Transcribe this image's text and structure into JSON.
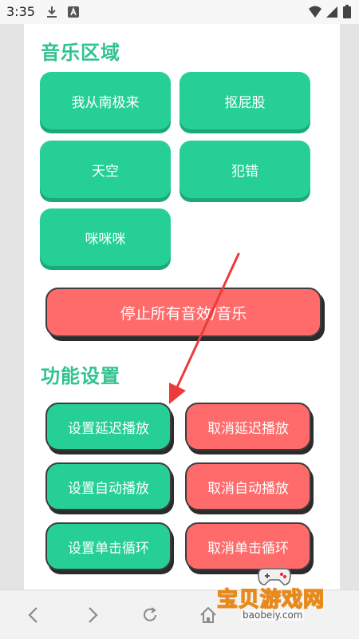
{
  "status_bar": {
    "time": "3:35",
    "icons": [
      "download-icon",
      "app-a-icon",
      "wifi-icon",
      "signal-icon",
      "battery-icon"
    ]
  },
  "music_section": {
    "title": "音乐区域",
    "buttons": [
      "我从南极来",
      "抠屁股",
      "天空",
      "犯错",
      "咪咪咪"
    ]
  },
  "stop_button": {
    "label": "停止所有音效/音乐"
  },
  "function_section": {
    "title": "功能设置",
    "rows": [
      {
        "set_label": "设置延迟播放",
        "cancel_label": "取消延迟播放"
      },
      {
        "set_label": "设置自动播放",
        "cancel_label": "取消自动播放"
      },
      {
        "set_label": "设置单击循环",
        "cancel_label": "取消单击循环"
      }
    ]
  },
  "browser_nav": {
    "icons": [
      "back-icon",
      "forward-icon",
      "reload-icon",
      "home-icon"
    ]
  },
  "watermark": {
    "title": "宝贝游戏网",
    "url": "baobeiy.com"
  },
  "colors": {
    "accent_green": "#26cf96",
    "title_green": "#2fc38e",
    "cancel_red": "#ff6a6a",
    "arrow_red": "#ec3b3b"
  }
}
